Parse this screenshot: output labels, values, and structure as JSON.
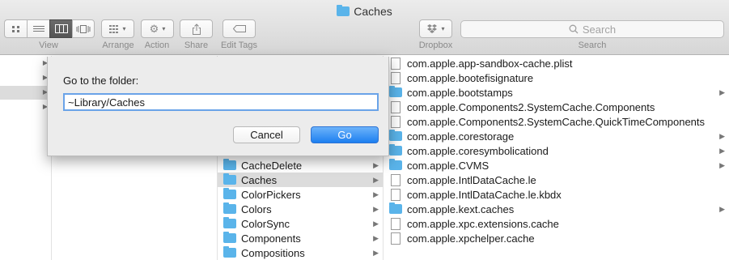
{
  "window": {
    "title": "Caches"
  },
  "toolbar": {
    "labels": {
      "view": "View",
      "arrange": "Arrange",
      "action": "Action",
      "share": "Share",
      "edit_tags": "Edit Tags",
      "dropbox": "Dropbox",
      "search": "Search"
    },
    "search_placeholder": "Search",
    "view_modes": [
      "icon-view-icon",
      "list-view-icon",
      "column-view-icon",
      "cover-flow-icon"
    ],
    "active_view": "column"
  },
  "dialog": {
    "label": "Go to the folder:",
    "input_value": "~Library/Caches",
    "cancel_label": "Cancel",
    "go_label": "Go"
  },
  "library_column": [
    {
      "name": "CacheDelete",
      "selected": false
    },
    {
      "name": "Caches",
      "selected": true
    },
    {
      "name": "ColorPickers",
      "selected": false
    },
    {
      "name": "Colors",
      "selected": false
    },
    {
      "name": "ColorSync",
      "selected": false
    },
    {
      "name": "Components",
      "selected": false
    },
    {
      "name": "Compositions",
      "selected": false
    }
  ],
  "caches_column": [
    {
      "name": "com.apple.app-sandbox-cache.plist",
      "kind": "file"
    },
    {
      "name": "com.apple.bootefisignature",
      "kind": "file"
    },
    {
      "name": "com.apple.bootstamps",
      "kind": "folder"
    },
    {
      "name": "com.apple.Components2.SystemCache.Components",
      "kind": "file"
    },
    {
      "name": "com.apple.Components2.SystemCache.QuickTimeComponents",
      "kind": "file"
    },
    {
      "name": "com.apple.corestorage",
      "kind": "folder"
    },
    {
      "name": "com.apple.coresymbolicationd",
      "kind": "folder"
    },
    {
      "name": "com.apple.CVMS",
      "kind": "folder"
    },
    {
      "name": "com.apple.IntlDataCache.le",
      "kind": "file"
    },
    {
      "name": "com.apple.IntlDataCache.le.kbdx",
      "kind": "file"
    },
    {
      "name": "com.apple.kext.caches",
      "kind": "folder"
    },
    {
      "name": "com.apple.xpc.extensions.cache",
      "kind": "file"
    },
    {
      "name": "com.apple.xpchelper.cache",
      "kind": "file"
    }
  ],
  "colors": {
    "accent": "#1d7ff0",
    "folder": "#5ab4ea",
    "selection": "#dcdcdc"
  }
}
